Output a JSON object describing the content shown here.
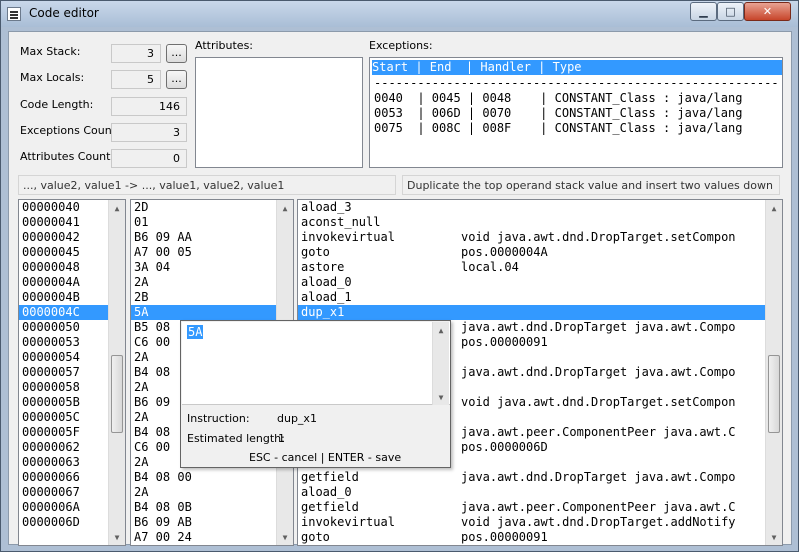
{
  "window": {
    "title": "Code editor",
    "min_glyph": "▁",
    "max_glyph": "□",
    "close_glyph": "✕"
  },
  "fields": {
    "max_stack": {
      "label": "Max Stack:",
      "value": "3",
      "button": "..."
    },
    "max_locals": {
      "label": "Max Locals:",
      "value": "5",
      "button": "..."
    },
    "code_length": {
      "label": "Code Length:",
      "value": "146"
    },
    "exceptions_count": {
      "label": "Exceptions Count:",
      "value": "3"
    },
    "attributes_count": {
      "label": "Attributes Count:",
      "value": "0"
    }
  },
  "attributes": {
    "label": "Attributes:"
  },
  "exceptions": {
    "label": "Exceptions:",
    "header": "Start | End  | Handler | Type",
    "separator": "--------------------------------------------------------------------",
    "rows": [
      "0040  | 0045 | 0048    | CONSTANT_Class : java/lang",
      "0053  | 006D | 0070    | CONSTANT_Class : java/lang",
      "0075  | 008C | 008F    | CONSTANT_Class : java/lang"
    ]
  },
  "status": {
    "stack_effect": "..., value2, value1 -> ..., value1, value2, value1",
    "description": "Duplicate the top operand stack value and insert two values down"
  },
  "offsets": [
    "00000040",
    "00000041",
    "00000042",
    "00000045",
    "00000048",
    "0000004A",
    "0000004B",
    "0000004C",
    "00000050",
    "00000053",
    "00000054",
    "00000057",
    "00000058",
    "0000005B",
    "0000005C",
    "0000005F",
    "00000062",
    "00000063",
    "00000066",
    "00000067",
    "0000006A",
    "0000006D"
  ],
  "bytes": [
    "2D",
    "01",
    "B6 09 AA",
    "A7 00 05",
    "3A 04",
    "2A",
    "2B",
    "5A",
    "B5 08",
    "C6 00",
    "2A",
    "B4 08",
    "2A",
    "B6 09",
    "2A",
    "B4 08",
    "C6 00",
    "2A",
    "B4 08 00",
    "2A",
    "B4 08 0B",
    "B6 09 AB",
    "A7 00 24"
  ],
  "instructions": [
    {
      "op": "aload_3",
      "arg": ""
    },
    {
      "op": "aconst_null",
      "arg": ""
    },
    {
      "op": "invokevirtual",
      "arg": "void java.awt.dnd.DropTarget.setCompon"
    },
    {
      "op": "goto",
      "arg": "pos.0000004A"
    },
    {
      "op": "astore",
      "arg": "local.04"
    },
    {
      "op": "aload_0",
      "arg": ""
    },
    {
      "op": "aload_1",
      "arg": ""
    },
    {
      "op": "dup_x1",
      "arg": ""
    },
    {
      "op": "",
      "arg": "java.awt.dnd.DropTarget java.awt.Compo"
    },
    {
      "op": "",
      "arg": "pos.00000091"
    },
    {
      "op": "",
      "arg": ""
    },
    {
      "op": "",
      "arg": "java.awt.dnd.DropTarget java.awt.Compo"
    },
    {
      "op": "",
      "arg": ""
    },
    {
      "op": "",
      "arg": "void java.awt.dnd.DropTarget.setCompon"
    },
    {
      "op": "",
      "arg": ""
    },
    {
      "op": "",
      "arg": "java.awt.peer.ComponentPeer java.awt.C"
    },
    {
      "op": "",
      "arg": "pos.0000006D"
    },
    {
      "op": "",
      "arg": ""
    },
    {
      "op": "getfield",
      "arg": "java.awt.dnd.DropTarget java.awt.Compo"
    },
    {
      "op": "aload_0",
      "arg": ""
    },
    {
      "op": "getfield",
      "arg": "java.awt.peer.ComponentPeer java.awt.C"
    },
    {
      "op": "invokevirtual",
      "arg": "void java.awt.dnd.DropTarget.addNotify"
    },
    {
      "op": "goto",
      "arg": "pos.00000091"
    }
  ],
  "popup": {
    "value": "5A",
    "instruction_label": "Instruction:",
    "instruction_value": "dup_x1",
    "length_label": "Estimated length:",
    "length_value": "1",
    "hint": "ESC - cancel | ENTER - save"
  }
}
